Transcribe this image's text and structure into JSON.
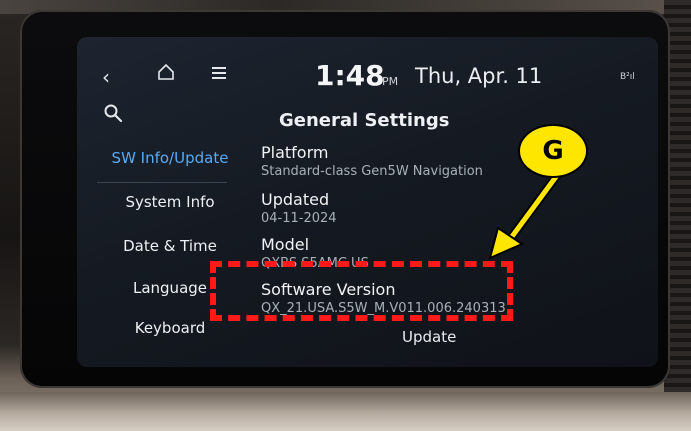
{
  "status_bar": {
    "time": "1:48",
    "ampm": "PM",
    "date": "Thu, Apr. 11",
    "bt_status": "B²ıl"
  },
  "header": {
    "title": "General Settings"
  },
  "sidebar": {
    "items": [
      {
        "label": "SW Info/Update",
        "active": true
      },
      {
        "label": "System Info",
        "active": false
      },
      {
        "label": "Date & Time",
        "active": false
      },
      {
        "label": "Language",
        "active": false
      },
      {
        "label": "Keyboard",
        "active": false
      }
    ]
  },
  "content": {
    "platform": {
      "label": "Platform",
      "value": "Standard-class Gen5W Navigation"
    },
    "updated": {
      "label": "Updated",
      "value": "04-11-2024"
    },
    "model": {
      "label": "Model",
      "value": "QXBS S5AMC US"
    },
    "software_version": {
      "label": "Software Version",
      "value": "QX_21.USA.S5W_M.V011.006.240313"
    },
    "update_button": "Update"
  },
  "annotation": {
    "badge_letter": "G",
    "badge_color": "#ffe600",
    "highlight_color": "#ff1a1a"
  },
  "colors": {
    "accent": "#5aaaf5",
    "screen_bg": "#151a22"
  },
  "icons": [
    "back-icon",
    "home-icon",
    "menu-icon",
    "search-icon",
    "bluetooth-signal-icon"
  ]
}
